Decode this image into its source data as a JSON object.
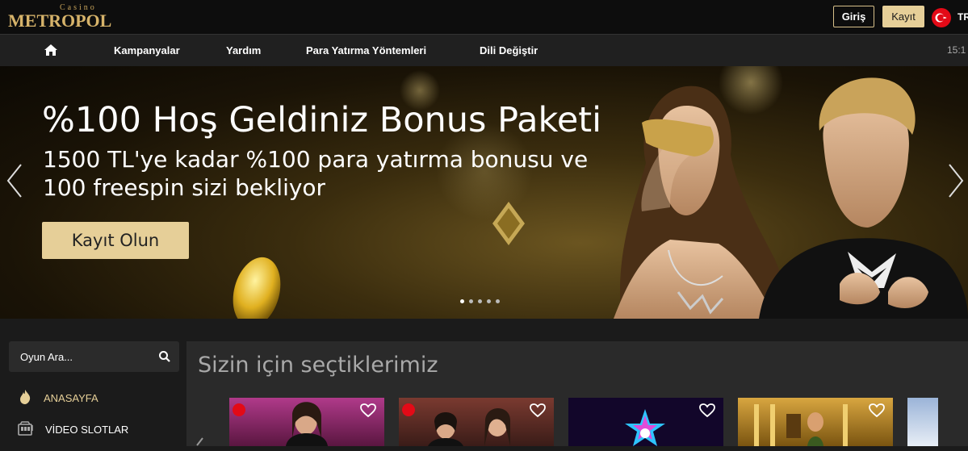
{
  "header": {
    "logo_small": "Casino",
    "logo_big": "METROPOL",
    "login_label": "Giriş",
    "register_label": "Kayıt",
    "language": "TR"
  },
  "nav": {
    "items": [
      "Kampanyalar",
      "Yardım",
      "Para Yatırma Yöntemleri",
      "Dili Değiştir"
    ],
    "time": "15:1"
  },
  "hero": {
    "title": "%100 Hoş Geldiniz Bonus Paketi",
    "subtitle": "1500 TL'ye kadar %100 para yatırma bonusu ve 100 freespin sizi bekliyor",
    "cta_label": "Kayıt Olun",
    "slide_count": 5,
    "active_slide": 1
  },
  "sidebar": {
    "search_placeholder": "Oyun Ara...",
    "items": [
      {
        "label": "ANASAYFA",
        "icon": "flame-icon",
        "active": true
      },
      {
        "label": "VİDEO SLOTLAR",
        "icon": "slot-machine-icon",
        "active": false
      }
    ]
  },
  "main": {
    "section_title": "Sizin için seçtiklerimiz"
  },
  "colors": {
    "accent": "#e6cf98",
    "gold": "#d6b36a",
    "background": "#1b1b1b",
    "panel": "#2a2a2a"
  }
}
